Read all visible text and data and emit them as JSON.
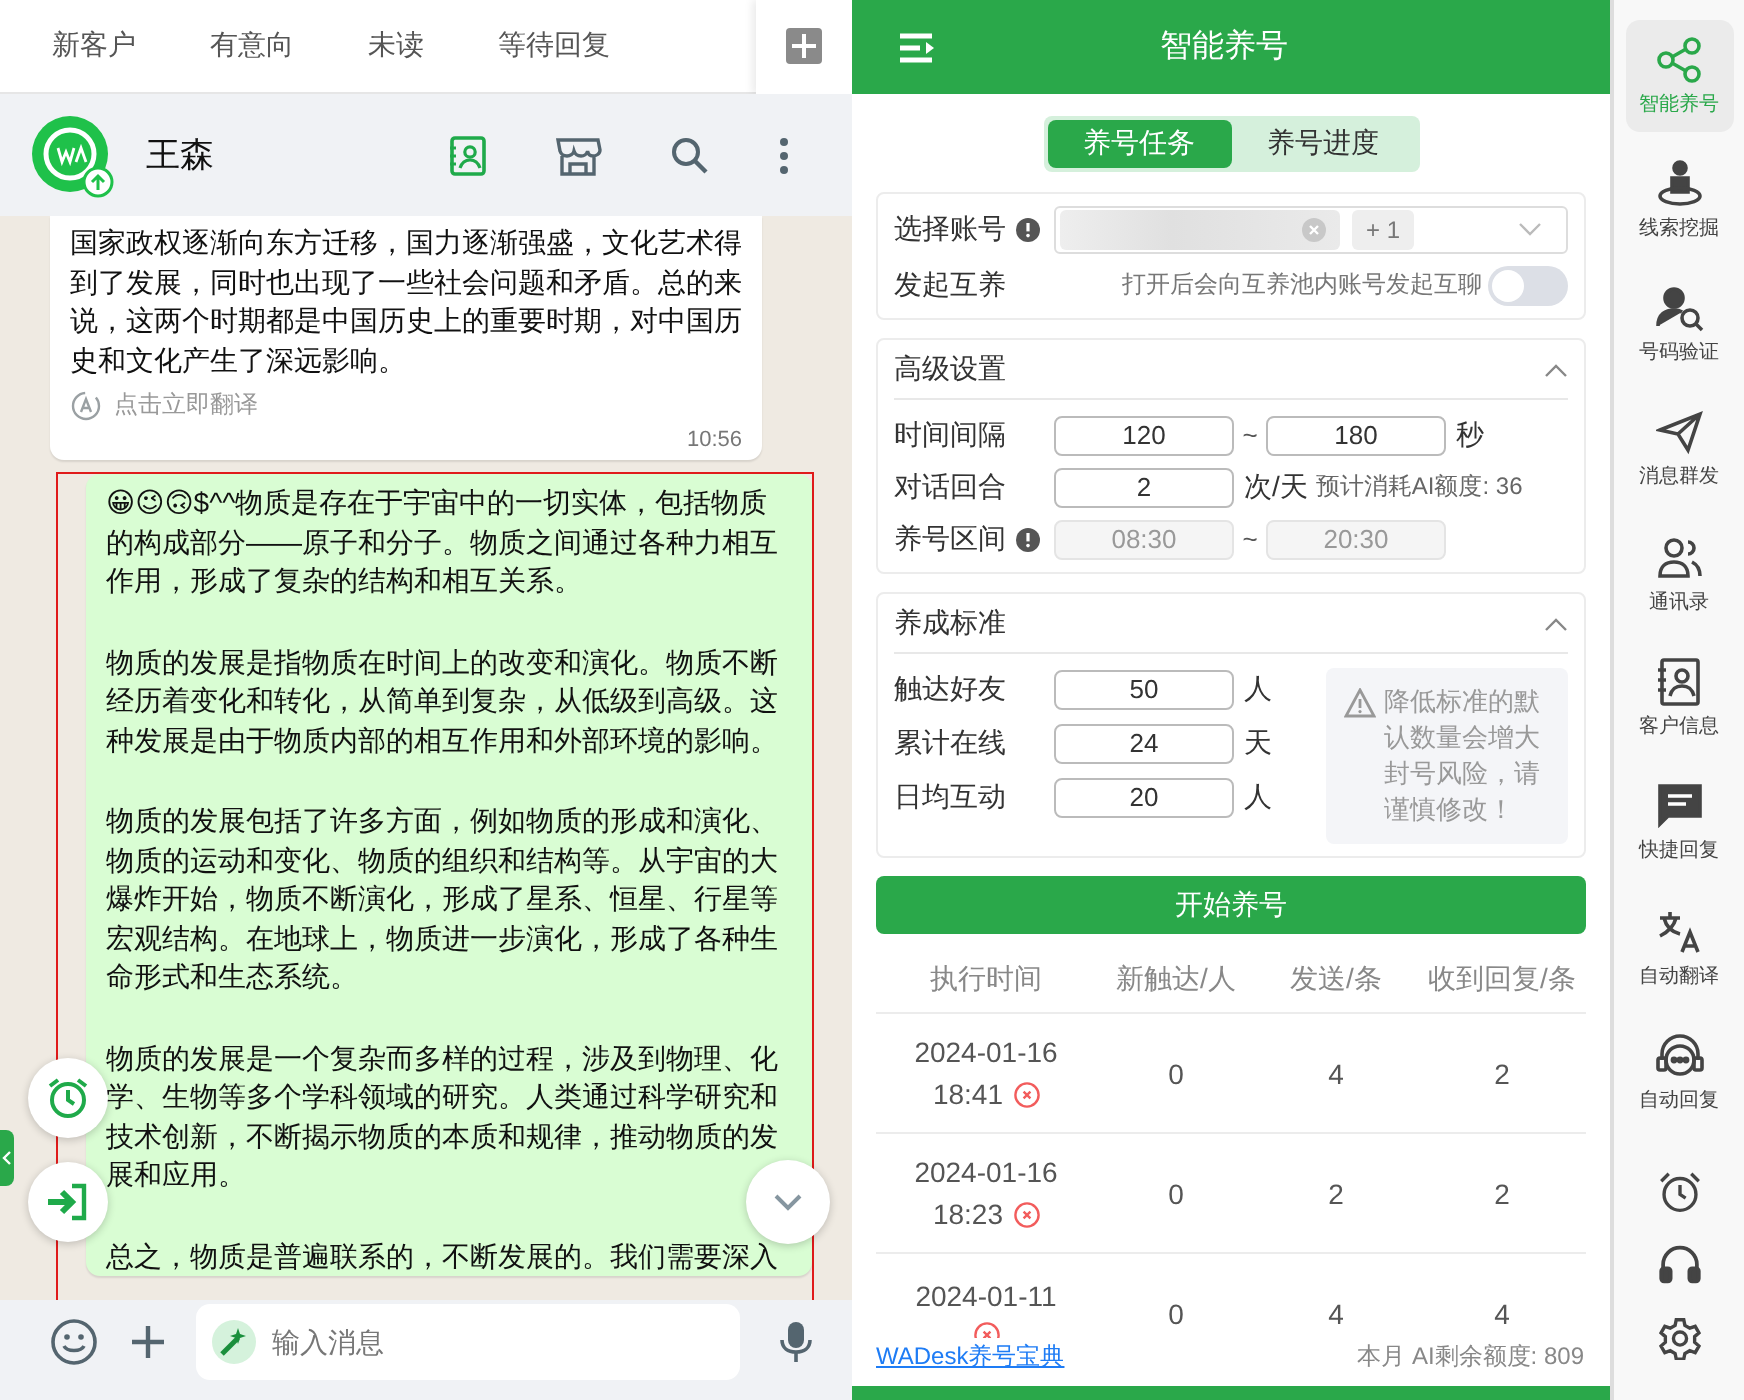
{
  "chat_tabs": [
    {
      "label": "新客户"
    },
    {
      "label": "有意向"
    },
    {
      "label": "未读"
    },
    {
      "label": "等待回复"
    }
  ],
  "chat_header": {
    "name": "王森"
  },
  "messages": [
    {
      "kind": "received",
      "highlighted": false,
      "paragraphs": [
        "国家政权逐渐向东方迁移，国力逐渐强盛，文化艺术得到了发展，同时也出现了一些社会问题和矛盾。总的来说，这两个时期都是中国历史上的重要时期，对中国历史和文化产生了深远影响。"
      ],
      "translate_label": "点击立即翻译",
      "time": "10:56"
    },
    {
      "kind": "sent",
      "highlighted": true,
      "paragraphs": [
        "😀😉🙃$^^物质是存在于宇宙中的一切实体，包括物质的构成部分——原子和分子。物质之间通过各种力相互作用，形成了复杂的结构和相互关系。",
        "物质的发展是指物质在时间上的改变和演化。物质不断经历着变化和转化，从简单到复杂，从低级到高级。这种发展是由于物质内部的相互作用和外部环境的影响。",
        "物质的发展包括了许多方面，例如物质的形成和演化、物质的运动和变化、物质的组织和结构等。从宇宙的大爆炸开始，物质不断演化，形成了星系、恒星、行星等宏观结构。在地球上，物质进一步演化，形成了各种生命形式和生态系统。",
        "物质的发展是一个复杂而多样的过程，涉及到物理、化学、生物等多个学科领域的研究。人类通过科学研究和技术创新，不断揭示物质的本质和规律，推动物质的发展和应用。",
        "总之，物质是普遍联系的，不断发展的。我们需要深入"
      ]
    }
  ],
  "composer": {
    "placeholder": "输入消息"
  },
  "panel": {
    "title": "智能养号",
    "tabs": [
      {
        "label": "养号任务",
        "selected": true
      },
      {
        "label": "养号进度",
        "selected": false
      }
    ],
    "account": {
      "label": "选择账号",
      "extra_count": "+ 1"
    },
    "mutual": {
      "label": "发起互养",
      "hint": "打开后会向互养池内账号发起互聊",
      "on": false
    },
    "advanced": {
      "title": "高级设置",
      "expanded": true,
      "interval": {
        "label": "时间间隔",
        "from": "120",
        "separator": "~",
        "to": "180",
        "unit": "秒"
      },
      "rounds": {
        "label": "对话回合",
        "value": "2",
        "unit": "次/天",
        "note": "预计消耗AI额度: 36"
      },
      "window": {
        "label": "养号区间",
        "from": "08:30",
        "separator": "~",
        "to": "20:30",
        "disabled": true
      }
    },
    "standard": {
      "title": "养成标准",
      "expanded": true,
      "rows": [
        {
          "label": "触达好友",
          "value": "50",
          "unit": "人"
        },
        {
          "label": "累计在线",
          "value": "24",
          "unit": "天"
        },
        {
          "label": "日均互动",
          "value": "20",
          "unit": "人"
        }
      ],
      "warning": "降低标准的默认数量会增大封号风险，请谨慎修改！"
    },
    "start_button": "开始养号",
    "table": {
      "columns": [
        "执行时间",
        "新触达/人",
        "发送/条",
        "收到回复/条"
      ],
      "rows": [
        {
          "cells": [
            "2024-01-16",
            "0",
            "4",
            "2"
          ],
          "time": "18:41",
          "failed": true
        },
        {
          "cells": [
            "2024-01-16",
            "0",
            "2",
            "2"
          ],
          "time": "18:23",
          "failed": true
        },
        {
          "cells": [
            "2024-01-11",
            "0",
            "4",
            "4"
          ],
          "failed": true
        }
      ]
    },
    "footer": {
      "link": "WADesk养号宝典",
      "quota": "本月 AI剩余额度: 809"
    }
  },
  "sidebar": {
    "items": [
      {
        "label": "智能养号",
        "selected": true
      },
      {
        "label": "线索挖掘",
        "selected": false
      },
      {
        "label": "号码验证",
        "selected": false
      },
      {
        "label": "消息群发",
        "selected": false
      },
      {
        "label": "通讯录",
        "selected": false
      },
      {
        "label": "客户信息",
        "selected": false
      },
      {
        "label": "快捷回复",
        "selected": false
      },
      {
        "label": "自动翻译",
        "selected": false
      },
      {
        "label": "自动回复",
        "selected": false
      }
    ]
  }
}
